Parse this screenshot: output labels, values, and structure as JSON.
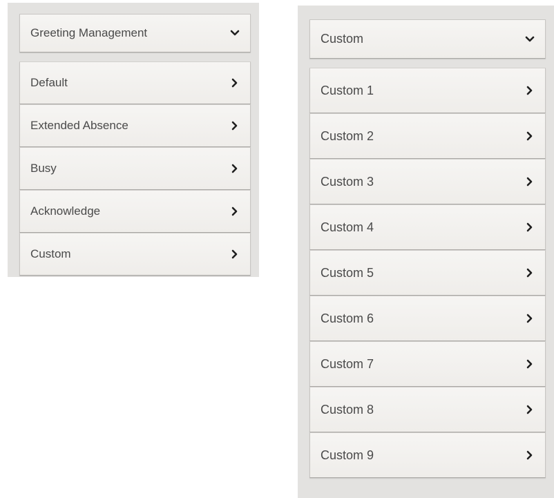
{
  "left_panel": {
    "header": {
      "label": "Greeting Management",
      "icon": "chevron-down-icon"
    },
    "items": [
      {
        "label": "Default",
        "icon": "chevron-right-icon"
      },
      {
        "label": "Extended Absence",
        "icon": "chevron-right-icon"
      },
      {
        "label": "Busy",
        "icon": "chevron-right-icon"
      },
      {
        "label": "Acknowledge",
        "icon": "chevron-right-icon"
      },
      {
        "label": "Custom",
        "icon": "chevron-right-icon"
      }
    ]
  },
  "right_panel": {
    "header": {
      "label": "Custom",
      "icon": "chevron-down-icon"
    },
    "items": [
      {
        "label": "Custom 1",
        "icon": "chevron-right-icon"
      },
      {
        "label": "Custom 2",
        "icon": "chevron-right-icon"
      },
      {
        "label": "Custom 3",
        "icon": "chevron-right-icon"
      },
      {
        "label": "Custom 4",
        "icon": "chevron-right-icon"
      },
      {
        "label": "Custom 5",
        "icon": "chevron-right-icon"
      },
      {
        "label": "Custom 6",
        "icon": "chevron-right-icon"
      },
      {
        "label": "Custom 7",
        "icon": "chevron-right-icon"
      },
      {
        "label": "Custom 8",
        "icon": "chevron-right-icon"
      },
      {
        "label": "Custom 9",
        "icon": "chevron-right-icon"
      }
    ]
  },
  "colors": {
    "panel_background": "#e3e2e0",
    "row_background": "#f3f1ee",
    "text": "#4a4a4a",
    "icon": "#1f1f1f"
  }
}
